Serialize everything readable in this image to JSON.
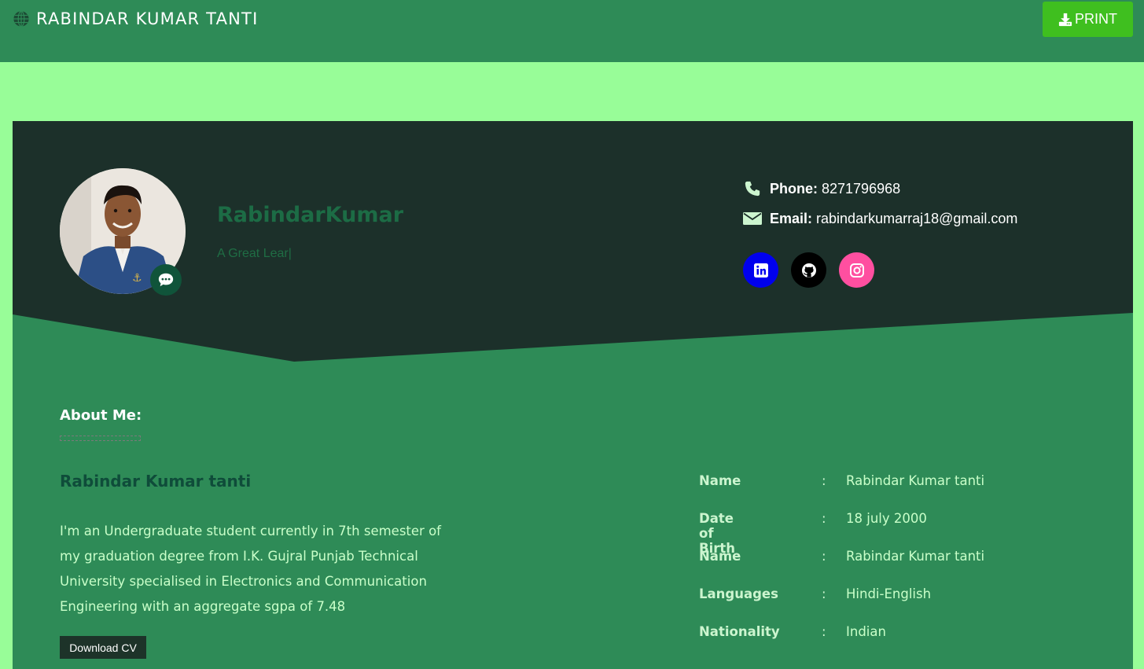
{
  "header": {
    "brand_icon": "globe-icon",
    "brand": "RABINDAR KUMAR TANTI",
    "print_icon": "download-icon",
    "print_label": "PRINT"
  },
  "profile": {
    "name": "RabindarKumar",
    "tagline": "A Great Lear|",
    "badge_icon": "chat-icon"
  },
  "contact": {
    "phone_label": "Phone:",
    "phone": "8271796968",
    "email_label": "Email:",
    "email": "rabindarkumarraj18@gmail.com"
  },
  "socials": [
    {
      "name": "linkedin",
      "icon": "linkedin-icon",
      "color": "#0000ee"
    },
    {
      "name": "github",
      "icon": "github-icon",
      "color": "#000000"
    },
    {
      "name": "instagram",
      "icon": "instagram-icon",
      "color": "#ff4fa0"
    }
  ],
  "about": {
    "title": "About Me:",
    "subname": "Rabindar Kumar tanti",
    "bio": "I'm an Undergraduate student currently in 7th semester of my graduation degree from I.K. Gujral Punjab Technical University specialised in Electronics and Communication Engineering with an aggregate sgpa of 7.48",
    "download_label": "Download CV"
  },
  "info": [
    {
      "label": "Name",
      "colon": ":",
      "value": "Rabindar Kumar tanti"
    },
    {
      "label": "Date of Birth",
      "colon": ":",
      "value": "18 july 2000"
    },
    {
      "label": "Name",
      "colon": ":",
      "value": "Rabindar Kumar tanti"
    },
    {
      "label": "Languages",
      "colon": ":",
      "value": "Hindi-English"
    },
    {
      "label": "Nationality",
      "colon": ":",
      "value": "Indian"
    }
  ],
  "colors": {
    "header_bg": "#2e8b57",
    "page_bg": "#98fd98",
    "hero_bg": "#1c302a",
    "print_button": "#3fbf1f"
  }
}
